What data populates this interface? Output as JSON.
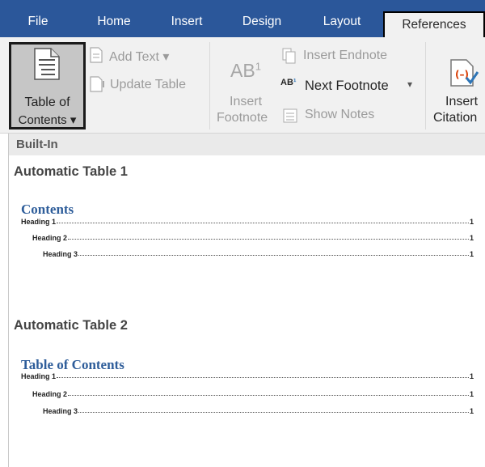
{
  "tabs": [
    {
      "label": "File"
    },
    {
      "label": "Home"
    },
    {
      "label": "Insert"
    },
    {
      "label": "Design"
    },
    {
      "label": "Layout"
    },
    {
      "label": "References"
    }
  ],
  "ribbon": {
    "toc_line1": "Table of",
    "toc_line2": "Contents ▾",
    "add_text": "Add Text ▾",
    "update_table": "Update Table",
    "ab_glyph": "AB",
    "ab_sup": "1",
    "insert_footnote_1": "Insert",
    "insert_footnote_2": "Footnote",
    "insert_endnote": "Insert Endnote",
    "next_footnote": "Next Footnote",
    "next_footnote_arrow": "▾",
    "show_notes": "Show Notes",
    "insert_citation_1": "Insert",
    "insert_citation_2": "Citation"
  },
  "gallery": {
    "builtin_label": "Built-In",
    "auto1": {
      "title": "Automatic Table 1",
      "toc_heading": "Contents",
      "lines": [
        {
          "label": "Heading 1",
          "page": "1"
        },
        {
          "label": "Heading 2",
          "page": "1"
        },
        {
          "label": "Heading 3",
          "page": "1"
        }
      ]
    },
    "auto2": {
      "title": "Automatic Table 2",
      "toc_heading": "Table of Contents",
      "lines": [
        {
          "label": "Heading 1",
          "page": "1"
        },
        {
          "label": "Heading 2",
          "page": "1"
        },
        {
          "label": "Heading 3",
          "page": "1"
        }
      ]
    }
  },
  "colors": {
    "ribbon_tab_bar": "#2b579a",
    "ribbon_body": "#f1f1f1",
    "toc_heading_blue": "#2e5d9a",
    "citation_accent": "#d83b01"
  }
}
